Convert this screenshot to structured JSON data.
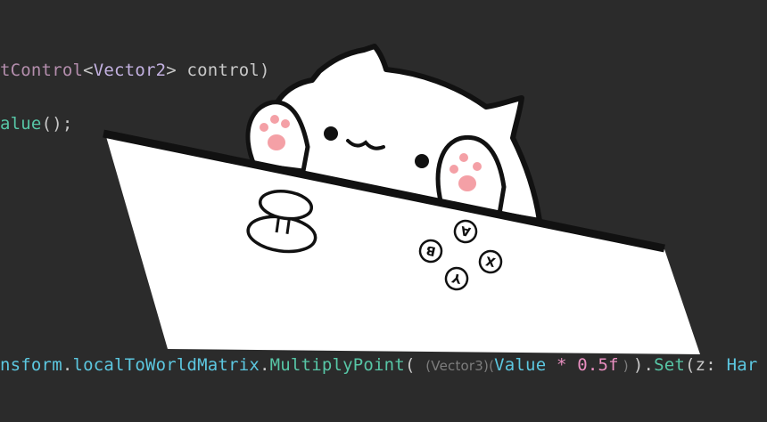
{
  "editor": {
    "line1": {
      "t1": "tControl",
      "t2": "<",
      "t3": "Vector2",
      "t4": "> control)"
    },
    "line2": {
      "t1": "alue",
      "t2": "();"
    },
    "line3": {
      "t1": "nsform",
      "t2": ".",
      "t3": "localToWorldMatrix",
      "t4": ".",
      "t5": "MultiplyPoint",
      "t6": "( ",
      "hint1": "(Vector3)(",
      "t7": "Value",
      "t8": " * ",
      "t9": "0.5f",
      "hint2": " ) ",
      "t10": ").",
      "t11": "Set",
      "t12": "(z: ",
      "t13": "Har"
    }
  },
  "controller": {
    "button_a": "A",
    "button_b": "B",
    "button_x": "X",
    "button_y": "Y"
  },
  "colors": {
    "background": "#2b2b2b",
    "table": "#ffffff",
    "outline": "#111111",
    "paw_pad": "#f4a0a6"
  }
}
